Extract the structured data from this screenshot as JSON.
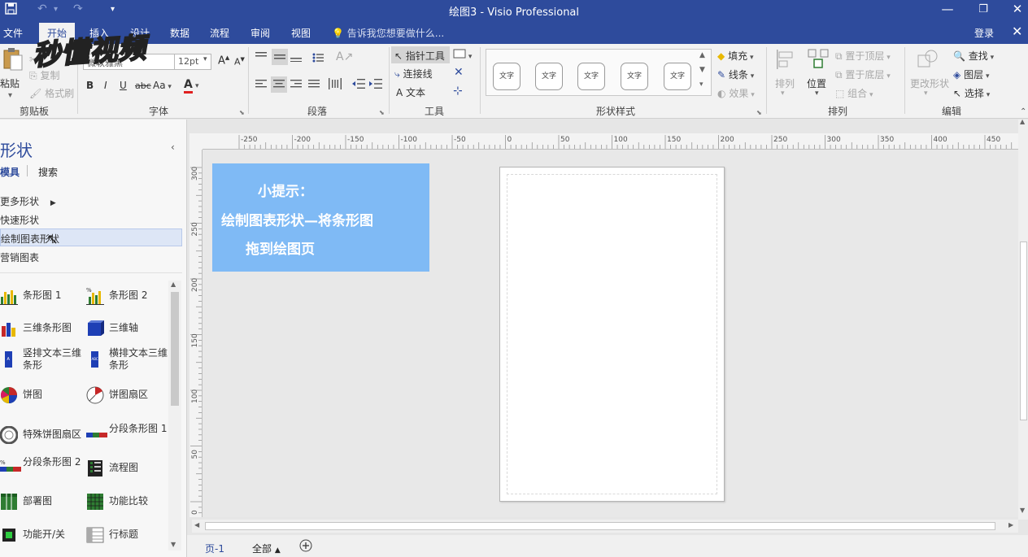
{
  "titlebar": {
    "title": "绘图3 - Visio Professional",
    "save_icon": "save-icon",
    "undo_icon": "undo-icon",
    "redo_icon": "redo-icon",
    "customize_icon": "customize-qat-icon",
    "minimize": "—",
    "restore": "❐",
    "close": "✕"
  },
  "menubar": {
    "tabs": [
      "文件",
      "开始",
      "插入",
      "设计",
      "数据",
      "流程",
      "审阅",
      "视图"
    ],
    "active_tab": "开始",
    "tell_me": "告诉我您想要做什么...",
    "login": "登录",
    "close": "✕"
  },
  "logo": {
    "text": "秒懂视频"
  },
  "ribbon": {
    "clipboard": {
      "label": "剪贴板",
      "paste": "粘贴",
      "cut": "剪切",
      "copy": "复制",
      "format_painter": "格式刷"
    },
    "font": {
      "label": "字体",
      "font_name": "微软雅黑",
      "font_size": "12pt",
      "bold": "B",
      "italic": "I",
      "underline": "U",
      "strike": "abc",
      "case": "Aa",
      "font_color": "A"
    },
    "paragraph": {
      "label": "段落"
    },
    "tools": {
      "label": "工具",
      "pointer": "指针工具",
      "connector": "连接线",
      "text": "文本"
    },
    "shape_styles": {
      "label": "形状样式",
      "style_text": "文字",
      "fill": "填充",
      "line": "线条",
      "effects": "效果"
    },
    "arrange": {
      "label": "排列",
      "align": "排列",
      "position": "位置",
      "bring_front": "置于顶层",
      "send_back": "置于底层",
      "group": "组合"
    },
    "edit": {
      "label": "编辑",
      "change_shape": "更改形状",
      "find": "查找",
      "layers": "图层",
      "select": "选择"
    }
  },
  "leftpane": {
    "title": "形状",
    "tab_stencils": "模具",
    "tab_search": "搜索",
    "more_shapes": "更多形状",
    "quick_shapes": "快速形状",
    "chart_shapes": "绘制图表形状",
    "marketing_charts": "营销图表",
    "stencils": [
      {
        "label": "条形图 1",
        "icon": "bar-chart-icon"
      },
      {
        "label": "条形图 2",
        "icon": "bar-chart-percent-icon"
      },
      {
        "label": "三维条形图",
        "icon": "3d-bar-chart-icon"
      },
      {
        "label": "三维轴",
        "icon": "3d-axis-icon"
      },
      {
        "label": "竖排文本三维条形",
        "icon": "vertical-text-bar-icon"
      },
      {
        "label": "横排文本三维条形",
        "icon": "horizontal-text-bar-icon"
      },
      {
        "label": "饼图",
        "icon": "pie-chart-icon"
      },
      {
        "label": "饼图扇区",
        "icon": "pie-sector-icon"
      },
      {
        "label": "特殊饼图扇区",
        "icon": "special-pie-sector-icon"
      },
      {
        "label": "分段条形图 1",
        "icon": "segmented-bar-icon"
      },
      {
        "label": "分段条形图 2",
        "icon": "segmented-bar-percent-icon"
      },
      {
        "label": "流程图",
        "icon": "flowchart-icon"
      },
      {
        "label": "部署图",
        "icon": "deployment-icon"
      },
      {
        "label": "功能比较",
        "icon": "feature-compare-icon"
      },
      {
        "label": "功能开/关",
        "icon": "feature-toggle-icon"
      },
      {
        "label": "行标题",
        "icon": "row-header-icon"
      }
    ]
  },
  "ruler": {
    "top_ticks": [
      "-250",
      "-200",
      "-150",
      "-100",
      "-50",
      "0",
      "50",
      "100",
      "150",
      "200",
      "250",
      "300",
      "350",
      "400",
      "450"
    ],
    "left_ticks": [
      "300",
      "250",
      "200",
      "150",
      "100",
      "50",
      "0"
    ]
  },
  "tip": {
    "line1": "小提示：",
    "line2": "绘制图表形状—将条形图",
    "line3": "拖到绘图页"
  },
  "pagebar": {
    "page1": "页-1",
    "all": "全部",
    "add_icon": "add-page-icon"
  }
}
